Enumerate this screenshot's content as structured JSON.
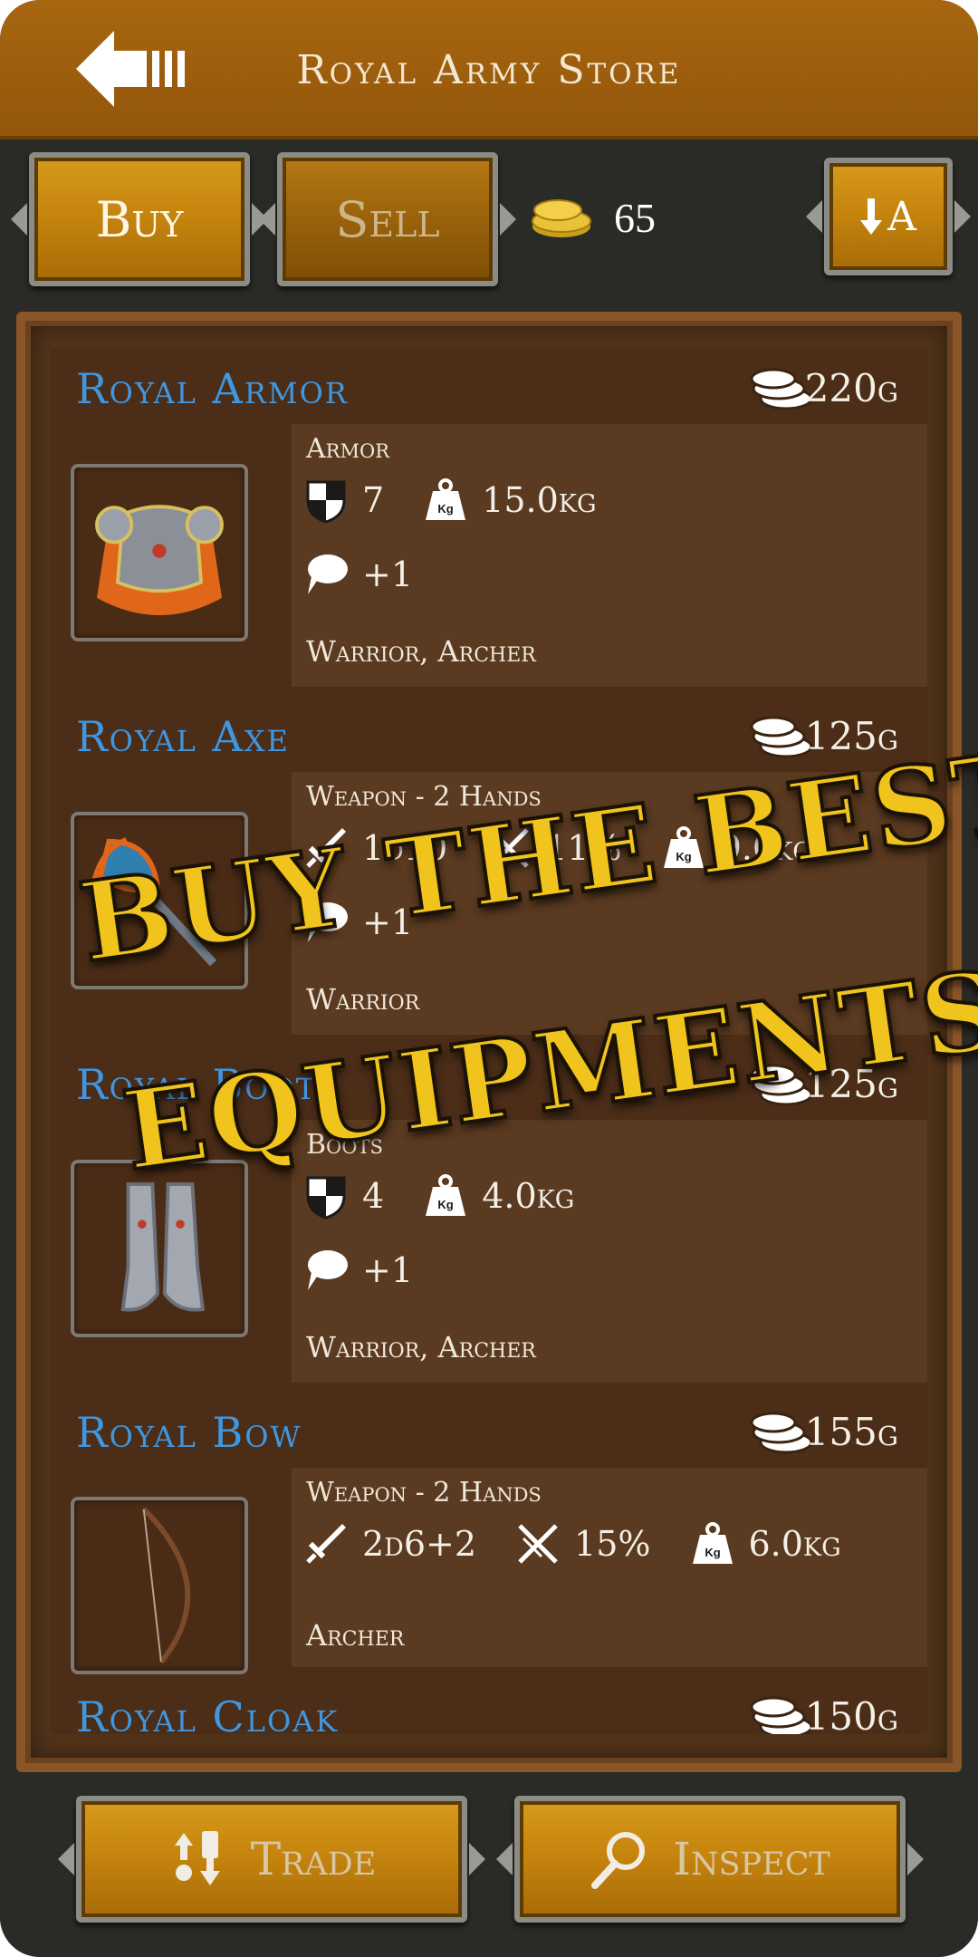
{
  "header": {
    "title": "Royal Army Store"
  },
  "toolbar": {
    "buy_label": "Buy",
    "sell_label": "Sell",
    "gold": "65",
    "sort_label": "A"
  },
  "items": [
    {
      "name": "Royal Armor",
      "price": "220g",
      "type": "Armor",
      "stats": {
        "defense": "7",
        "weight": "15.0kg",
        "bonus": "+1"
      },
      "classes": "Warrior, Archer"
    },
    {
      "name": "Royal Axe",
      "price": "125g",
      "type": "Weapon - 2 Hands",
      "stats": {
        "damage": "1d10",
        "crit": "11%",
        "weight": "9.0kg",
        "bonus": "+1"
      },
      "classes": "Warrior"
    },
    {
      "name": "Royal Boots",
      "price": "125g",
      "type": "Boots",
      "stats": {
        "defense": "4",
        "weight": "4.0kg",
        "bonus": "+1"
      },
      "classes": "Warrior, Archer"
    },
    {
      "name": "Royal Bow",
      "price": "155g",
      "type": "Weapon - 2 Hands",
      "stats": {
        "damage": "2d6+2",
        "crit": "15%",
        "weight": "6.0kg"
      },
      "classes": "Archer"
    },
    {
      "name": "Royal Cloak",
      "price": "150g"
    }
  ],
  "bottom": {
    "trade_label": "Trade",
    "inspect_label": "Inspect"
  },
  "promo": {
    "line1": "BUY THE BEST",
    "line2": "EQUIPMENTS"
  },
  "colors": {
    "header": "#a8660f",
    "item_name": "#3f97e2",
    "gold_button": "#c6850e",
    "promo_text": "#f0c41c"
  }
}
